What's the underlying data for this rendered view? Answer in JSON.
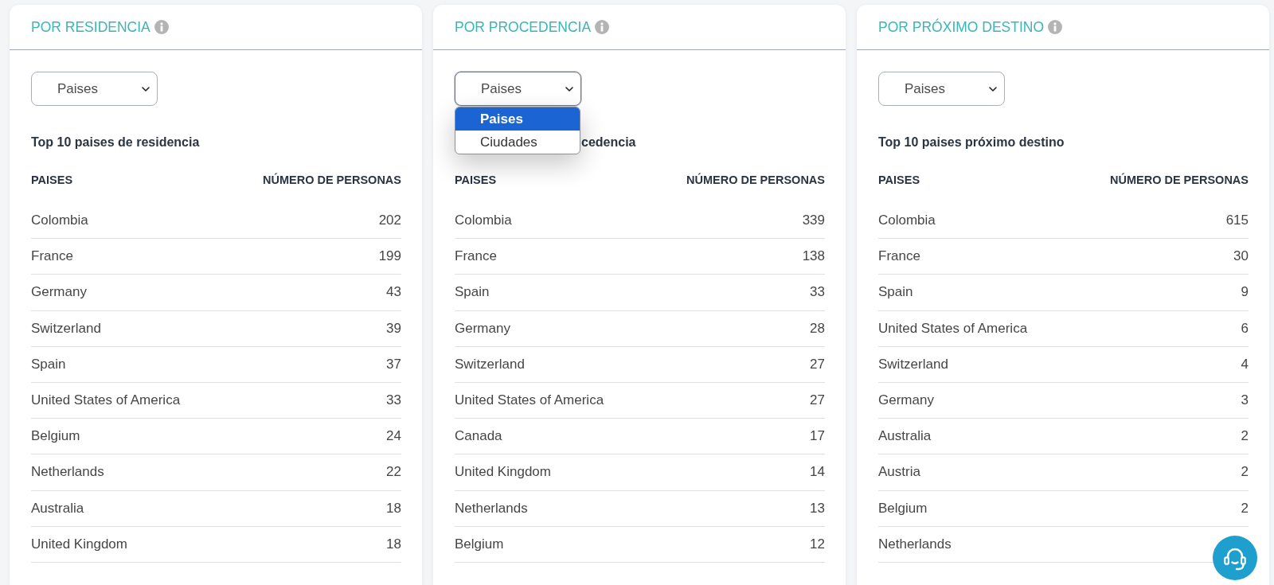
{
  "panels": [
    {
      "title": "POR RESIDENCIA",
      "select": {
        "value": "Paises",
        "expanded": false
      },
      "heading": "Top 10 paises de residencia",
      "columns": [
        "PAISES",
        "NÚMERO DE PERSONAS"
      ],
      "rows": [
        {
          "name": "Colombia",
          "value": "202"
        },
        {
          "name": "France",
          "value": "199"
        },
        {
          "name": "Germany",
          "value": "43"
        },
        {
          "name": "Switzerland",
          "value": "39"
        },
        {
          "name": "Spain",
          "value": "37"
        },
        {
          "name": "United States of America",
          "value": "33"
        },
        {
          "name": "Belgium",
          "value": "24"
        },
        {
          "name": "Netherlands",
          "value": "22"
        },
        {
          "name": "Australia",
          "value": "18"
        },
        {
          "name": "United Kingdom",
          "value": "18"
        }
      ]
    },
    {
      "title": "POR PROCEDENCIA",
      "select": {
        "value": "Paises",
        "expanded": true,
        "options": [
          {
            "label": "Paises",
            "selected": true
          },
          {
            "label": "Ciudades",
            "selected": false
          }
        ]
      },
      "heading": "cedencia",
      "columns": [
        "PAISES",
        "NÚMERO DE PERSONAS"
      ],
      "rows": [
        {
          "name": "Colombia",
          "value": "339"
        },
        {
          "name": "France",
          "value": "138"
        },
        {
          "name": "Spain",
          "value": "33"
        },
        {
          "name": "Germany",
          "value": "28"
        },
        {
          "name": "Switzerland",
          "value": "27"
        },
        {
          "name": "United States of America",
          "value": "27"
        },
        {
          "name": "Canada",
          "value": "17"
        },
        {
          "name": "United Kingdom",
          "value": "14"
        },
        {
          "name": "Netherlands",
          "value": "13"
        },
        {
          "name": "Belgium",
          "value": "12"
        }
      ]
    },
    {
      "title": "POR PRÓXIMO DESTINO",
      "select": {
        "value": "Paises",
        "expanded": false
      },
      "heading": "Top 10 paises próximo destino",
      "columns": [
        "PAISES",
        "NÚMERO DE PERSONAS"
      ],
      "rows": [
        {
          "name": "Colombia",
          "value": "615"
        },
        {
          "name": "France",
          "value": "30"
        },
        {
          "name": "Spain",
          "value": "9"
        },
        {
          "name": "United States of America",
          "value": "6"
        },
        {
          "name": "Switzerland",
          "value": "4"
        },
        {
          "name": "Germany",
          "value": "3"
        },
        {
          "name": "Australia",
          "value": "2"
        },
        {
          "name": "Austria",
          "value": "2"
        },
        {
          "name": "Belgium",
          "value": "2"
        },
        {
          "name": "Netherlands"
        }
      ]
    }
  ]
}
